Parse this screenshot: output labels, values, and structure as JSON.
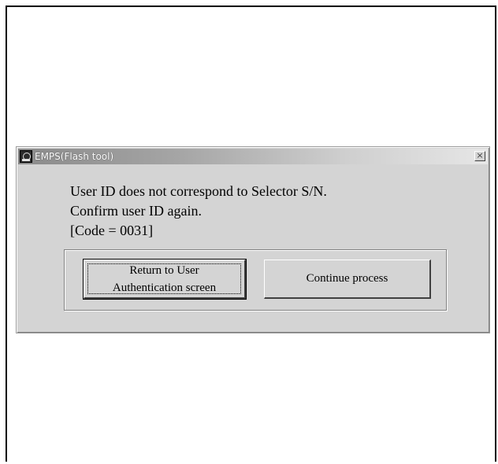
{
  "window": {
    "title": "EMPS(Flash tool)",
    "close_glyph": "×"
  },
  "message": {
    "lines": [
      "User ID does not correspond to Selector S/N.",
      "Confirm user ID again.",
      "[Code = 0031]"
    ]
  },
  "buttons": {
    "return_line1": "Return to User",
    "return_line2": "Authentication screen",
    "continue": "Continue process"
  },
  "icons": {
    "app": "app-icon",
    "close": "close-icon"
  }
}
